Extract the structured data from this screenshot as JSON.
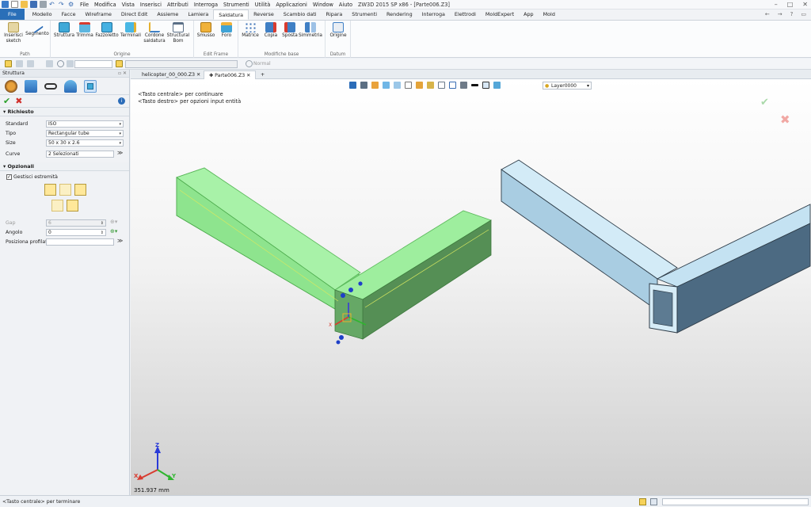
{
  "title": "ZW3D 2015 SP x86 - [Parte006.Z3]",
  "menubar": [
    "File",
    "Modifica",
    "Vista",
    "Inserisci",
    "Attributi",
    "Interroga",
    "Strumenti",
    "Utilità",
    "Applicazioni",
    "Window",
    "Aiuto"
  ],
  "ribbon_tabs": [
    "File",
    "Modello",
    "Facce",
    "Wireframe",
    "Direct Edit",
    "Assieme",
    "Lamiera",
    "Saldatura",
    "Reverse",
    "Scambio dati",
    "Ripara",
    "Strumenti",
    "Rendering",
    "Interroga",
    "Elettrodi",
    "MoldExpert",
    "App",
    "Mold"
  ],
  "active_tab": "Saldatura",
  "ribbon": {
    "groups": [
      {
        "label": "Path",
        "buttons": [
          {
            "label": "Inserisci sketch",
            "icon": "sketch-icon"
          },
          {
            "label": "Segmento",
            "icon": "segment-icon"
          }
        ]
      },
      {
        "label": "Origine",
        "buttons": [
          {
            "label": "Struttura",
            "icon": "structure-icon"
          },
          {
            "label": "Trimma",
            "icon": "trim-icon"
          },
          {
            "label": "Fazzoletto",
            "icon": "gusset-icon"
          },
          {
            "label": "Terminali",
            "icon": "endcap-icon"
          },
          {
            "label": "Cordone saldatura",
            "icon": "weld-bead-icon"
          },
          {
            "label": "Structural Bom",
            "icon": "bom-icon"
          }
        ]
      },
      {
        "label": "Edit Frame",
        "buttons": [
          {
            "label": "Smusso",
            "icon": "chamfer-icon"
          },
          {
            "label": "Foro",
            "icon": "hole-icon"
          }
        ]
      },
      {
        "label": "Modifiche base",
        "buttons": [
          {
            "label": "Matrice",
            "icon": "pattern-icon"
          },
          {
            "label": "Copia",
            "icon": "copy-icon"
          },
          {
            "label": "Sposta",
            "icon": "move-icon"
          },
          {
            "label": "Simmetria",
            "icon": "mirror-icon"
          }
        ]
      },
      {
        "label": "Datum",
        "buttons": [
          {
            "label": "Origine",
            "icon": "origin-icon"
          }
        ]
      }
    ]
  },
  "toolbar2": {
    "normal_label": "Normal"
  },
  "panel": {
    "title": "Struttura",
    "sections": {
      "required": "Richiesto",
      "optional": "Opzionali"
    },
    "fields": {
      "standard": {
        "label": "Standard",
        "value": "ISO"
      },
      "tipo": {
        "label": "Tipo",
        "value": "Rectangular tube"
      },
      "size": {
        "label": "Size",
        "value": "50 x 30 x 2.6"
      },
      "curve": {
        "label": "Curve",
        "value": "2 Selezionati"
      },
      "gestisci": {
        "label": "Gestisci estremità",
        "checked": true
      },
      "gap": {
        "label": "Gap",
        "value": "6"
      },
      "angolo": {
        "label": "Angolo",
        "value": "0"
      },
      "posizione": {
        "label": "Posiziona profilato",
        "value": ""
      }
    }
  },
  "doc_tabs": [
    "helicopter_00_000.Z3",
    "Parte006.Z3"
  ],
  "active_doc": "Parte006.Z3",
  "viewport": {
    "hint1": "<Tasto centrale> per continuare",
    "hint2": "<Tasto destro> per opzioni input entità",
    "layer": "Layer0000",
    "measure": "351.937 mm",
    "axis": {
      "x": "X",
      "y": "Y",
      "z": "Z"
    },
    "colors": {
      "tube_selected": "#99ee99",
      "tube_preview": "#c0dff0"
    }
  },
  "status": {
    "text": "<Tasto centrale> per terminare"
  }
}
